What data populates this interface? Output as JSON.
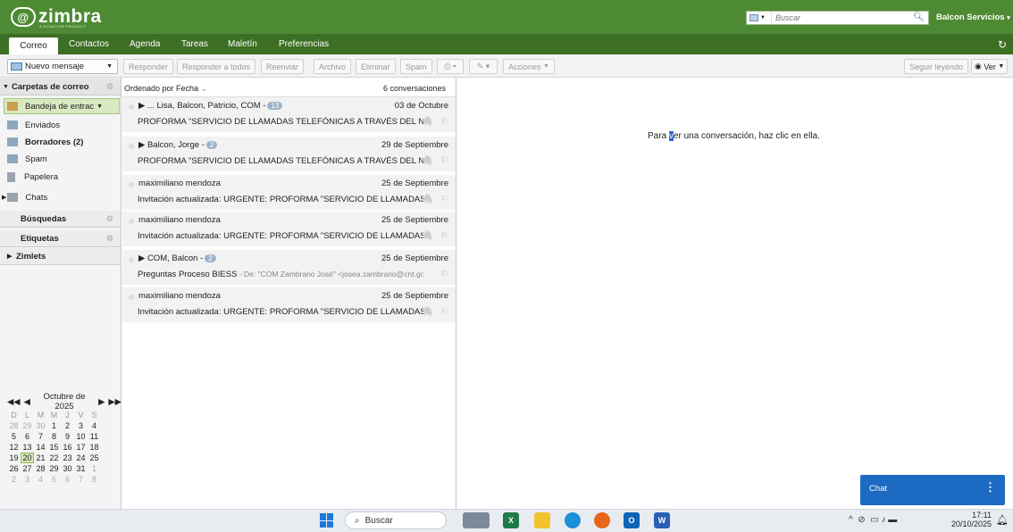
{
  "header": {
    "logo_text": "zimbra",
    "logo_subtext": "A SYNACOR PRODUCT",
    "search_placeholder": "Buscar",
    "user_name": "Balcon Servicios"
  },
  "app_tabs": [
    "Correo",
    "Contactos",
    "Agenda",
    "Tareas",
    "Maletín",
    "Preferencias"
  ],
  "toolbar": {
    "new_message": "Nuevo mensaje",
    "buttons": [
      "Responder",
      "Responder a todos",
      "Reenviar",
      "Archivo",
      "Eliminar",
      "Spam"
    ],
    "actions": "Acciones",
    "keep_reading": "Seguir leyendo",
    "view": "Ver"
  },
  "sidebar": {
    "folders_header": "Carpetas de correo",
    "folders": [
      {
        "label": "Bandeja de entrac",
        "icon": "inbox-icon"
      },
      {
        "label": "Enviados",
        "icon": "sent-icon"
      },
      {
        "label": "Borradores (2)",
        "icon": "drafts-icon"
      },
      {
        "label": "Spam",
        "icon": "spam-icon"
      },
      {
        "label": "Papelera",
        "icon": "trash-icon"
      },
      {
        "label": "Chats",
        "icon": "chat-folder-icon"
      }
    ],
    "searches_header": "Búsquedas",
    "tags_header": "Etiquetas",
    "zimlets_header": "Zimlets"
  },
  "calendar": {
    "month_label": "Octubre de 2025",
    "weekdays": [
      "D",
      "L",
      "M",
      "M",
      "J",
      "V",
      "S"
    ],
    "weeks": [
      [
        "28",
        "29",
        "30",
        "1",
        "2",
        "3",
        "4"
      ],
      [
        "5",
        "6",
        "7",
        "8",
        "9",
        "10",
        "11"
      ],
      [
        "12",
        "13",
        "14",
        "15",
        "16",
        "17",
        "18"
      ],
      [
        "19",
        "20",
        "21",
        "22",
        "23",
        "24",
        "25"
      ],
      [
        "26",
        "27",
        "28",
        "29",
        "30",
        "31",
        "1"
      ],
      [
        "2",
        "3",
        "4",
        "5",
        "6",
        "7",
        "8"
      ]
    ],
    "today": "20"
  },
  "message_list": {
    "sort_label": "Ordenado por Fecha",
    "count_label": "6 conversaciones",
    "conversations": [
      {
        "from": "▶ ... Lisa, Balcon, Patricio, COM -",
        "badge": "13",
        "date": "03 de Octubre",
        "subject": "PROFORMA \"SERVICIO DE LLAMADAS TELEFÓNICAS A TRAVÉS DEL NÚMER",
        "fragment": "",
        "attachment": true
      },
      {
        "from": "▶ Balcon, Jorge -",
        "badge": "2",
        "date": "29 de Septiembre",
        "subject": "PROFORMA \"SERVICIO DE LLAMADAS TELEFÓNICAS A TRAVÉS DEL NÚMER",
        "fragment": "",
        "attachment": true
      },
      {
        "from": "maximiliano mendoza",
        "badge": "",
        "date": "25 de Septiembre",
        "subject": "Invitación actualizada: URGENTE: PROFORMA \"SERVICIO DE LLAMADAS TELI",
        "fragment": "",
        "attachment": true
      },
      {
        "from": "maximiliano mendoza",
        "badge": "",
        "date": "25 de Septiembre",
        "subject": "Invitación actualizada: URGENTE: PROFORMA \"SERVICIO DE LLAMADAS TELI",
        "fragment": "",
        "attachment": true
      },
      {
        "from": "▶ COM, Balcon -",
        "badge": "2",
        "date": "25 de Septiembre",
        "subject": "Preguntas Proceso BIESS",
        "fragment": " - De: \"COM Zambrano José\" <josea.zambrano@cnt.gob",
        "attachment": false
      },
      {
        "from": "maximiliano mendoza",
        "badge": "",
        "date": "25 de Septiembre",
        "subject": "Invitación actualizada: URGENTE: PROFORMA \"SERVICIO DE LLAMADAS TELI",
        "fragment": "",
        "attachment": true
      }
    ]
  },
  "reading_pane": {
    "message_prefix": "Para ",
    "message_cursor": "v",
    "message_suffix": "er una conversación, haz clic en ella."
  },
  "chat": {
    "label": "Chat"
  },
  "taskbar": {
    "search_label": "Buscar",
    "time": "17:11",
    "date": "20/10/2025"
  }
}
